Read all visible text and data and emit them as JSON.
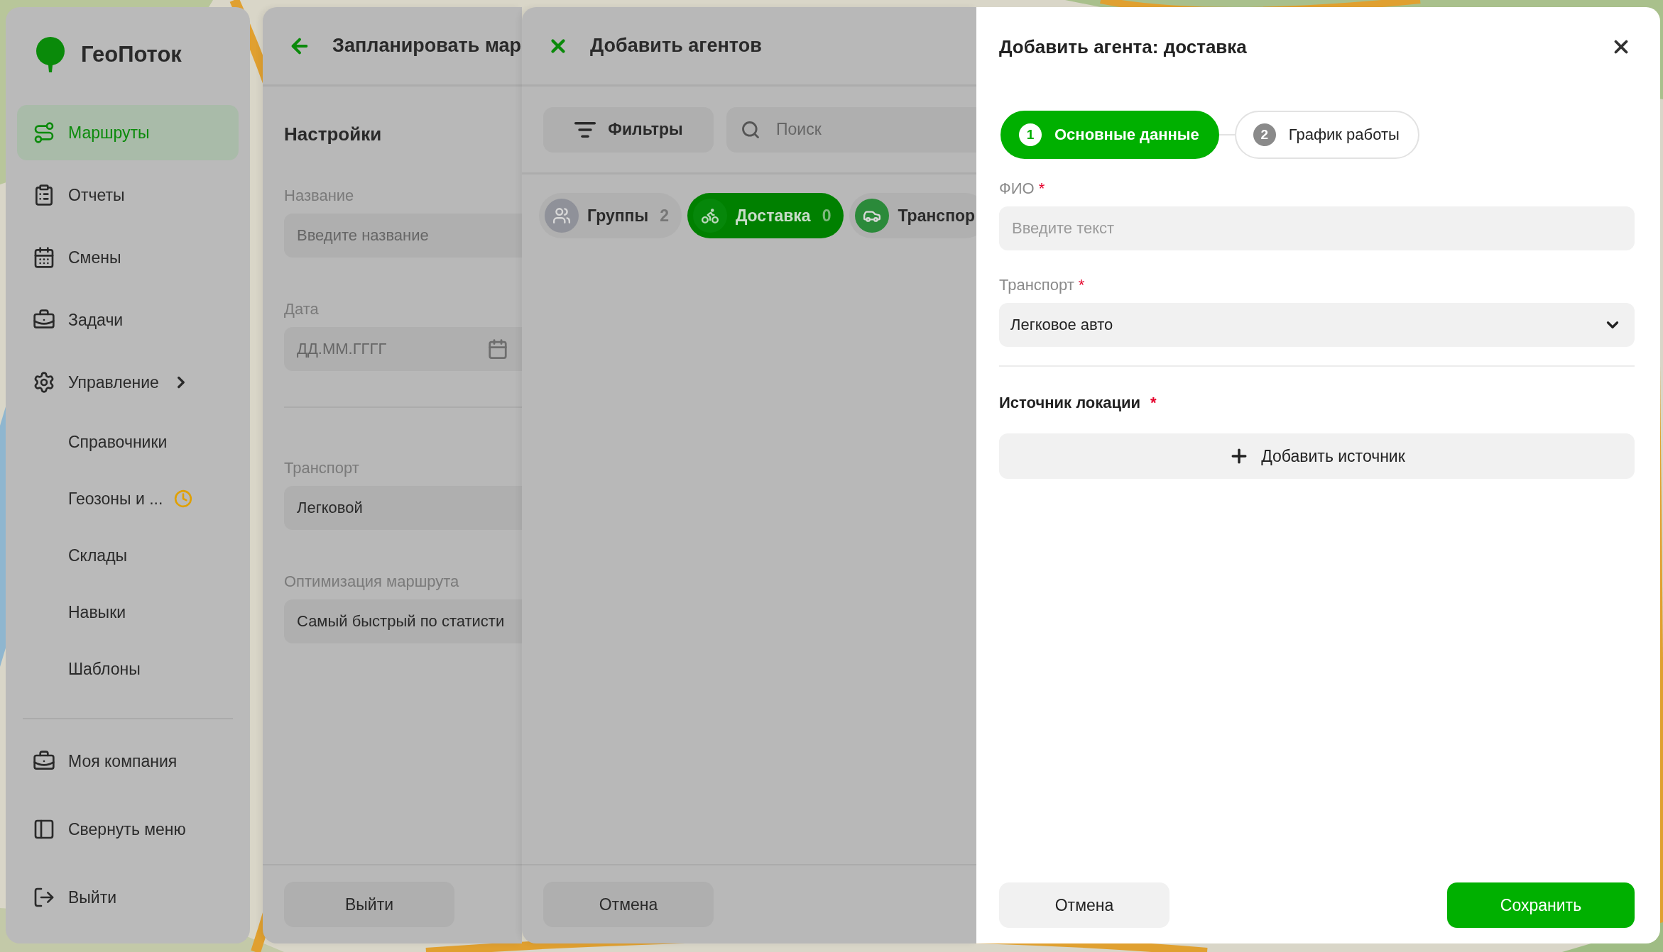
{
  "app": {
    "name": "ГеоПоток"
  },
  "sidebar": {
    "items": [
      {
        "kind": "nav",
        "label": "Маршруты",
        "selected": true
      },
      {
        "kind": "nav",
        "label": "Отчеты",
        "selected": false
      },
      {
        "kind": "nav",
        "label": "Смены",
        "selected": false
      },
      {
        "kind": "nav",
        "label": "Задачи",
        "selected": false
      },
      {
        "kind": "group",
        "label": "Управление",
        "selected": false
      },
      {
        "kind": "sub",
        "label": "Справочники",
        "selected": false,
        "pending": false
      },
      {
        "kind": "sub",
        "label": "Геозоны и ...",
        "selected": false,
        "pending": true
      },
      {
        "kind": "sub",
        "label": "Склады",
        "selected": false,
        "pending": false
      },
      {
        "kind": "sub",
        "label": "Навыки",
        "selected": false,
        "pending": false
      },
      {
        "kind": "sub",
        "label": "Шаблоны",
        "selected": false,
        "pending": false
      }
    ],
    "footer_items": [
      {
        "label": "Моя компания"
      },
      {
        "label": "Свернуть меню"
      },
      {
        "label": "Выйти"
      }
    ]
  },
  "plan_panel": {
    "title": "Запланировать мар",
    "section": "Настройки",
    "field_groups": [
      [
        {
          "kind": "text",
          "label": "Название",
          "placeholder": "Введите название"
        },
        {
          "kind": "date",
          "label": "Дата",
          "placeholder": "ДД.ММ.ГГГГ"
        }
      ],
      [
        {
          "kind": "select",
          "label": "Транспорт",
          "value": "Легковой"
        },
        {
          "kind": "select",
          "label": "Оптимизация маршрута",
          "value": "Самый быстрый по статисти"
        }
      ]
    ],
    "exit_button": "Выйти"
  },
  "agents_panel": {
    "title": "Добавить агентов",
    "filters_button": "Фильтры",
    "search": {
      "placeholder": "Поиск"
    },
    "chips": [
      {
        "label": "Группы",
        "count": "2",
        "selected": false,
        "color": "#8f9199"
      },
      {
        "label": "Доставка",
        "count": "0",
        "selected": true,
        "color": "#06870a"
      },
      {
        "label": "Транспор",
        "selected": false,
        "color": "#2b8a3a"
      }
    ],
    "cancel_button": "Отмена"
  },
  "modal": {
    "title": "Добавить агента: доставка",
    "steps": [
      {
        "number": "1",
        "label": "Основные данные",
        "selected": true
      },
      {
        "number": "2",
        "label": "График работы",
        "selected": false
      }
    ],
    "fields": [
      {
        "kind": "text",
        "label": "ФИО",
        "mark": "*",
        "placeholder": "Введите текст"
      },
      {
        "kind": "select",
        "label": "Транспорт",
        "mark": "*",
        "value": "Легковое авто"
      }
    ],
    "location": {
      "label": "Источник локации",
      "mark": "*",
      "add_button": "Добавить источник"
    },
    "cancel_button": "Отмена",
    "save_button": "Сохранить"
  }
}
